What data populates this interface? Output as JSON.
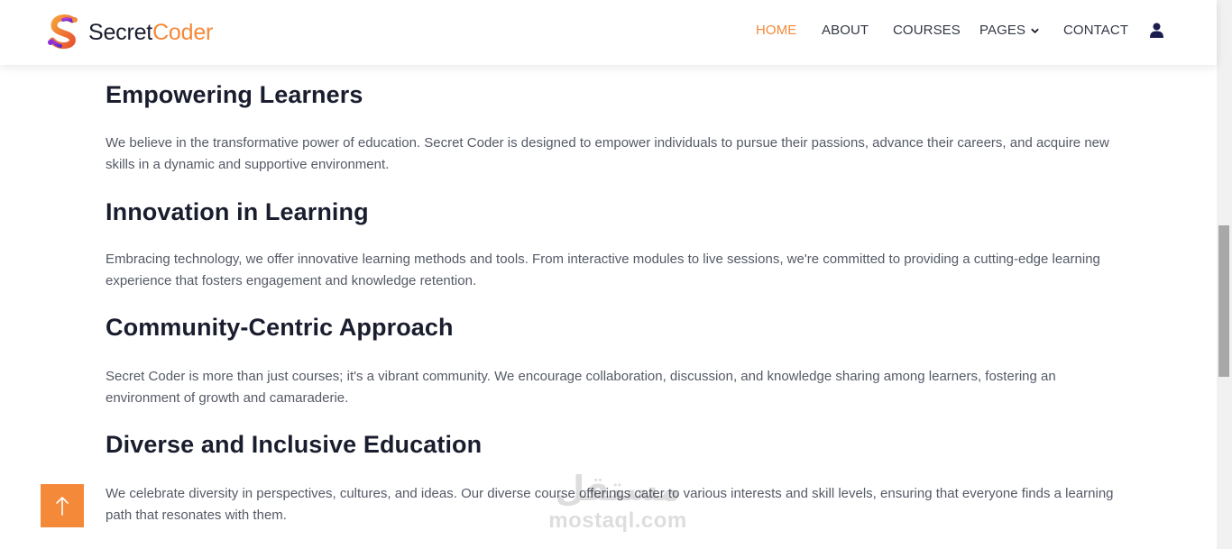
{
  "brand": {
    "name_part1": "Secret",
    "name_part2": "Coder",
    "accent_color": "#f5893a",
    "logo_icon": "s-logo-icon"
  },
  "nav": {
    "items": [
      {
        "label": "HOME",
        "active": true
      },
      {
        "label": "ABOUT",
        "active": false
      },
      {
        "label": "COURSES",
        "active": false
      },
      {
        "label": "PAGES",
        "active": false,
        "has_dropdown": true
      },
      {
        "label": "CONTACT",
        "active": false
      }
    ],
    "user_icon": "user-icon"
  },
  "sections": [
    {
      "title": "Empowering Learners",
      "text": "We believe in the transformative power of education. Secret Coder is designed to empower individuals to pursue their passions, advance their careers, and acquire new skills in a dynamic and supportive environment."
    },
    {
      "title": "Innovation in Learning",
      "text": "Embracing technology, we offer innovative learning methods and tools. From interactive modules to live sessions, we're committed to providing a cutting-edge learning experience that fosters engagement and knowledge retention."
    },
    {
      "title": "Community-Centric Approach",
      "text": "Secret Coder is more than just courses; it's a vibrant community. We encourage collaboration, discussion, and knowledge sharing among learners, fostering an environment of growth and camaraderie."
    },
    {
      "title": "Diverse and Inclusive Education",
      "text": "We celebrate diversity in perspectives, cultures, and ideas. Our diverse course offerings cater to various interests and skill levels, ensuring that everyone finds a learning path that resonates with them."
    }
  ],
  "back_to_top_icon": "arrow-up-icon",
  "watermark": {
    "arabic": "مستقل",
    "latin": "mostaql.com"
  }
}
